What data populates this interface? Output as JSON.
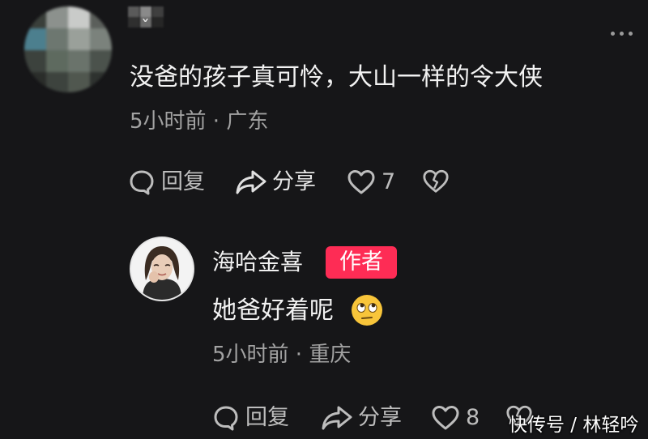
{
  "comment": {
    "author_visible": "ˇ",
    "text": "没爸的孩子真可怜，大山一样的令大侠",
    "meta": "5小时前 · 广东",
    "reply_label": "回复",
    "share_label": "分享",
    "like_count": "7"
  },
  "reply": {
    "author": "海哈金喜",
    "badge": "作者",
    "text": "她爸好着呢",
    "emoji": "face-with-rolling-eyes-emoji",
    "meta": "5小时前 · 重庆",
    "reply_label": "回复",
    "share_label": "分享",
    "like_count": "8"
  },
  "watermark": "快传号 / 林轻吟",
  "colors": {
    "background": "#161618",
    "badge": "#fe2c55",
    "secondary_text": "#a2a2a2"
  }
}
